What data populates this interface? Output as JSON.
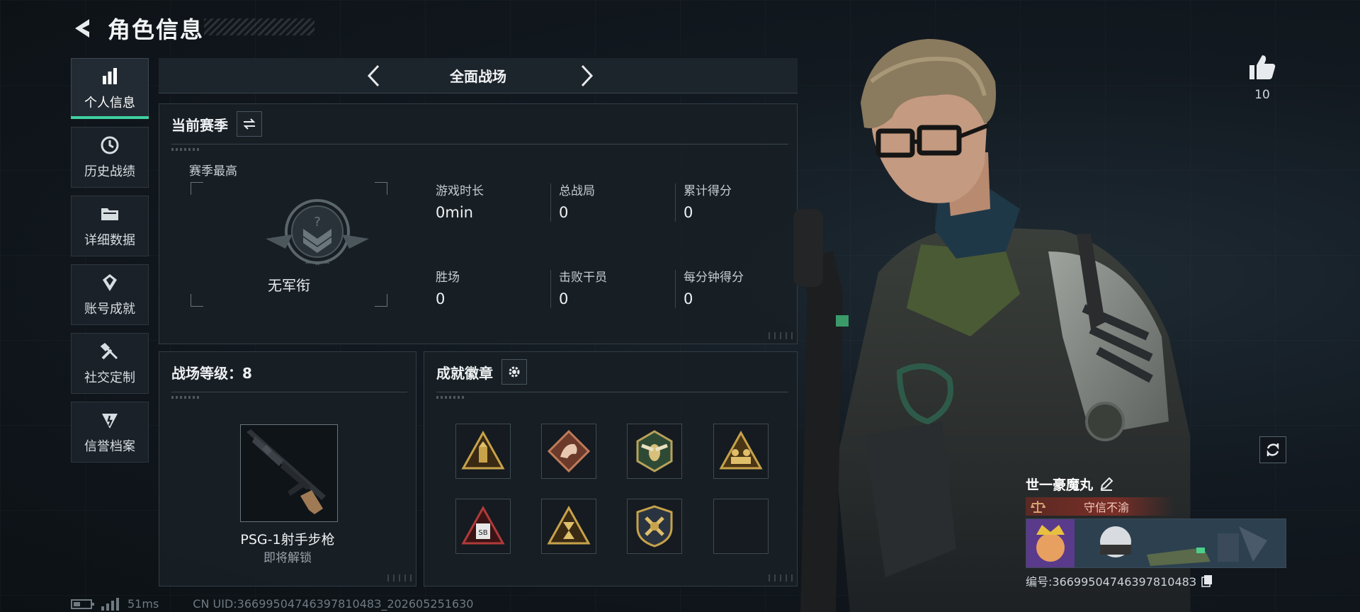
{
  "header": {
    "title": "角色信息",
    "back_icon": "back-arrow-icon"
  },
  "sidebar": {
    "items": [
      {
        "label": "个人信息",
        "icon": "bar-chart-icon",
        "active": true
      },
      {
        "label": "历史战绩",
        "icon": "history-icon",
        "active": false
      },
      {
        "label": "详细数据",
        "icon": "folder-icon",
        "active": false
      },
      {
        "label": "账号成就",
        "icon": "achievement-icon",
        "active": false
      },
      {
        "label": "社交定制",
        "icon": "tools-icon",
        "active": false
      },
      {
        "label": "信誉档案",
        "icon": "reputation-icon",
        "active": false
      }
    ]
  },
  "mode": {
    "title": "全面战场",
    "prev_icon": "chevron-left-icon",
    "next_icon": "chevron-right-icon"
  },
  "season": {
    "title": "当前赛季",
    "switch_icon": "swap-icon",
    "best_label": "赛季最高",
    "rank_name": "无军衔",
    "stats": [
      {
        "label": "游戏时长",
        "value": "0min"
      },
      {
        "label": "总战局",
        "value": "0"
      },
      {
        "label": "累计得分",
        "value": "0"
      },
      {
        "label": "胜场",
        "value": "0"
      },
      {
        "label": "击败干员",
        "value": "0"
      },
      {
        "label": "每分钟得分",
        "value": "0"
      }
    ]
  },
  "level": {
    "title": "战场等级：8",
    "weapon_name": "PSG-1射手步枪",
    "weapon_status": "即将解锁"
  },
  "badges": {
    "title": "成就徽章",
    "settings_icon": "gear-icon",
    "items": [
      {
        "icon": "ammo-badge-icon",
        "empty": false
      },
      {
        "icon": "dragon-badge-icon",
        "empty": false
      },
      {
        "icon": "wasp-badge-icon",
        "empty": false
      },
      {
        "icon": "squad-badge-icon",
        "empty": false
      },
      {
        "icon": "sb-badge-icon",
        "empty": false
      },
      {
        "icon": "hourglass-badge-icon",
        "empty": false
      },
      {
        "icon": "shield-badge-icon",
        "empty": false
      },
      {
        "icon": "empty-slot",
        "empty": true
      }
    ]
  },
  "profile": {
    "likes": "10",
    "player_name": "世一豪魔丸",
    "title_plate": "守信不渝",
    "player_id": "编号:3669950474639781048З"
  },
  "footer": {
    "ping": "51ms",
    "uid": "CN UID:3669950474639781048З_202605251630"
  },
  "colors": {
    "accent": "#3fd0a0",
    "title_plate": "#7a2e26",
    "gold": "#c8a24a"
  }
}
